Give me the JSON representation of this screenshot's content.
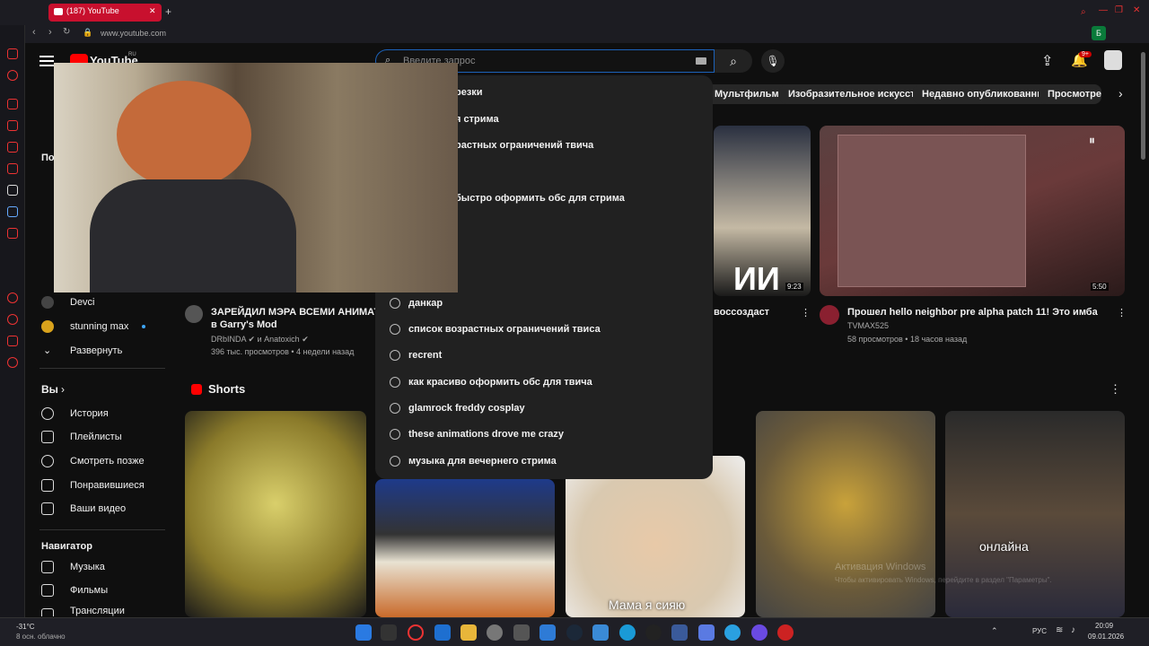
{
  "browser": {
    "tab_title": "(187) YouTube",
    "url": "www.youtube.com",
    "new_tab": "+"
  },
  "header": {
    "logo": "YouTube",
    "region": "RU",
    "search_placeholder": "Введите запрос",
    "notif_count": "9+"
  },
  "chips": [
    "Мультфильмы",
    "Изобразительное искусство",
    "Недавно опубликованные",
    "Просмотрено"
  ],
  "sidebar": {
    "subs_heading": "По",
    "channels": [
      "Devci",
      "stunning max"
    ],
    "expand": "Развернуть",
    "you_heading": "Вы",
    "you_items": [
      "История",
      "Плейлисты",
      "Смотреть позже",
      "Понравившиеся",
      "Ваши видео"
    ],
    "nav_heading": "Навигатор",
    "nav_items": [
      "Музыка",
      "Фильмы",
      "Трансляции"
    ]
  },
  "suggestions_partial": [
    "резки",
    "я стрима",
    "растных ограничений твича",
    "быстро оформить обс для стрима"
  ],
  "suggestions": [
    "данкар",
    "список возрастных ограничений твиса",
    "recrent",
    "как красиво оформить обс для твича",
    "glamrock freddy cosplay",
    "these animations drove me crazy",
    "музыка для вечернего стрима"
  ],
  "videos": [
    {
      "title_l1": "ЗАРЕЙДИЛ МЭРА ВСЕМИ АНИМАТР",
      "title_l2": "в Garry's Mod",
      "channel": "DRbINDA",
      "and": "и",
      "channel2": "Anatoxich",
      "stats": "396 тыс. просмотров • 4 недели назад"
    },
    {
      "title_l1": "воссоздаст",
      "duration": "9:23",
      "overlay": "ИИ"
    },
    {
      "title_l1": "Прошел hello neighbor pre alpha patch 11! Это имба",
      "channel": "TVMAX525",
      "stats": "58 просмотров • 18 часов назад",
      "duration": "5:50"
    }
  ],
  "shorts": {
    "heading": "Shorts",
    "captions": [
      "Мама я сияю",
      "онлайна"
    ]
  },
  "watermark": {
    "l1": "Активация Windows",
    "l2": "Чтобы активировать Windows, перейдите в раздел \"Параметры\"."
  },
  "taskbar": {
    "temp": "-31°C",
    "weather": "8 осн. облачно",
    "lang": "РУС",
    "time": "20:09",
    "date": "09.01.2026"
  },
  "colors": {
    "accent": "#ff0000",
    "bg": "#0f0f0f",
    "chip": "#272727"
  }
}
